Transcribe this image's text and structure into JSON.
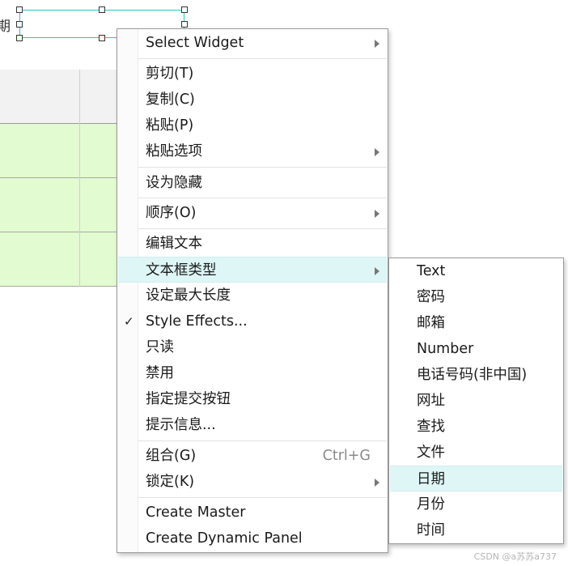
{
  "canvas": {
    "cut_char": "期"
  },
  "context_menu": {
    "items": [
      {
        "label": "Select Widget"
      },
      {
        "label": "剪切(T)"
      },
      {
        "label": "复制(C)"
      },
      {
        "label": "粘贴(P)"
      },
      {
        "label": "粘贴选项"
      },
      {
        "label": "设为隐藏"
      },
      {
        "label": "顺序(O)"
      },
      {
        "label": "编辑文本"
      },
      {
        "label": "文本框类型"
      },
      {
        "label": "设定最大长度"
      },
      {
        "label": "Style Effects..."
      },
      {
        "label": "只读"
      },
      {
        "label": "禁用"
      },
      {
        "label": "指定提交按钮"
      },
      {
        "label": "提示信息..."
      },
      {
        "label": "组合(G)",
        "shortcut": "Ctrl+G"
      },
      {
        "label": "锁定(K)"
      },
      {
        "label": "Create Master"
      },
      {
        "label": "Create Dynamic Panel"
      }
    ],
    "check_mark": "✓"
  },
  "textbox_type_submenu": {
    "items": [
      "Text",
      "密码",
      "邮箱",
      "Number",
      "电话号码(非中国)",
      "网址",
      "查找",
      "文件",
      "日期",
      "月份",
      "时间"
    ],
    "highlighted": "日期"
  },
  "watermark": "CSDN @a苏苏a737",
  "colors": {
    "selection_border": "#2ec4c4",
    "highlight_bg": "#dff6f6",
    "table_row_bg": "#e2fbd0",
    "table_header_bg": "#f2f2f2"
  },
  "icons": [
    "submenu-arrow-icon",
    "checkmark-icon",
    "resize-handle-icon"
  ]
}
